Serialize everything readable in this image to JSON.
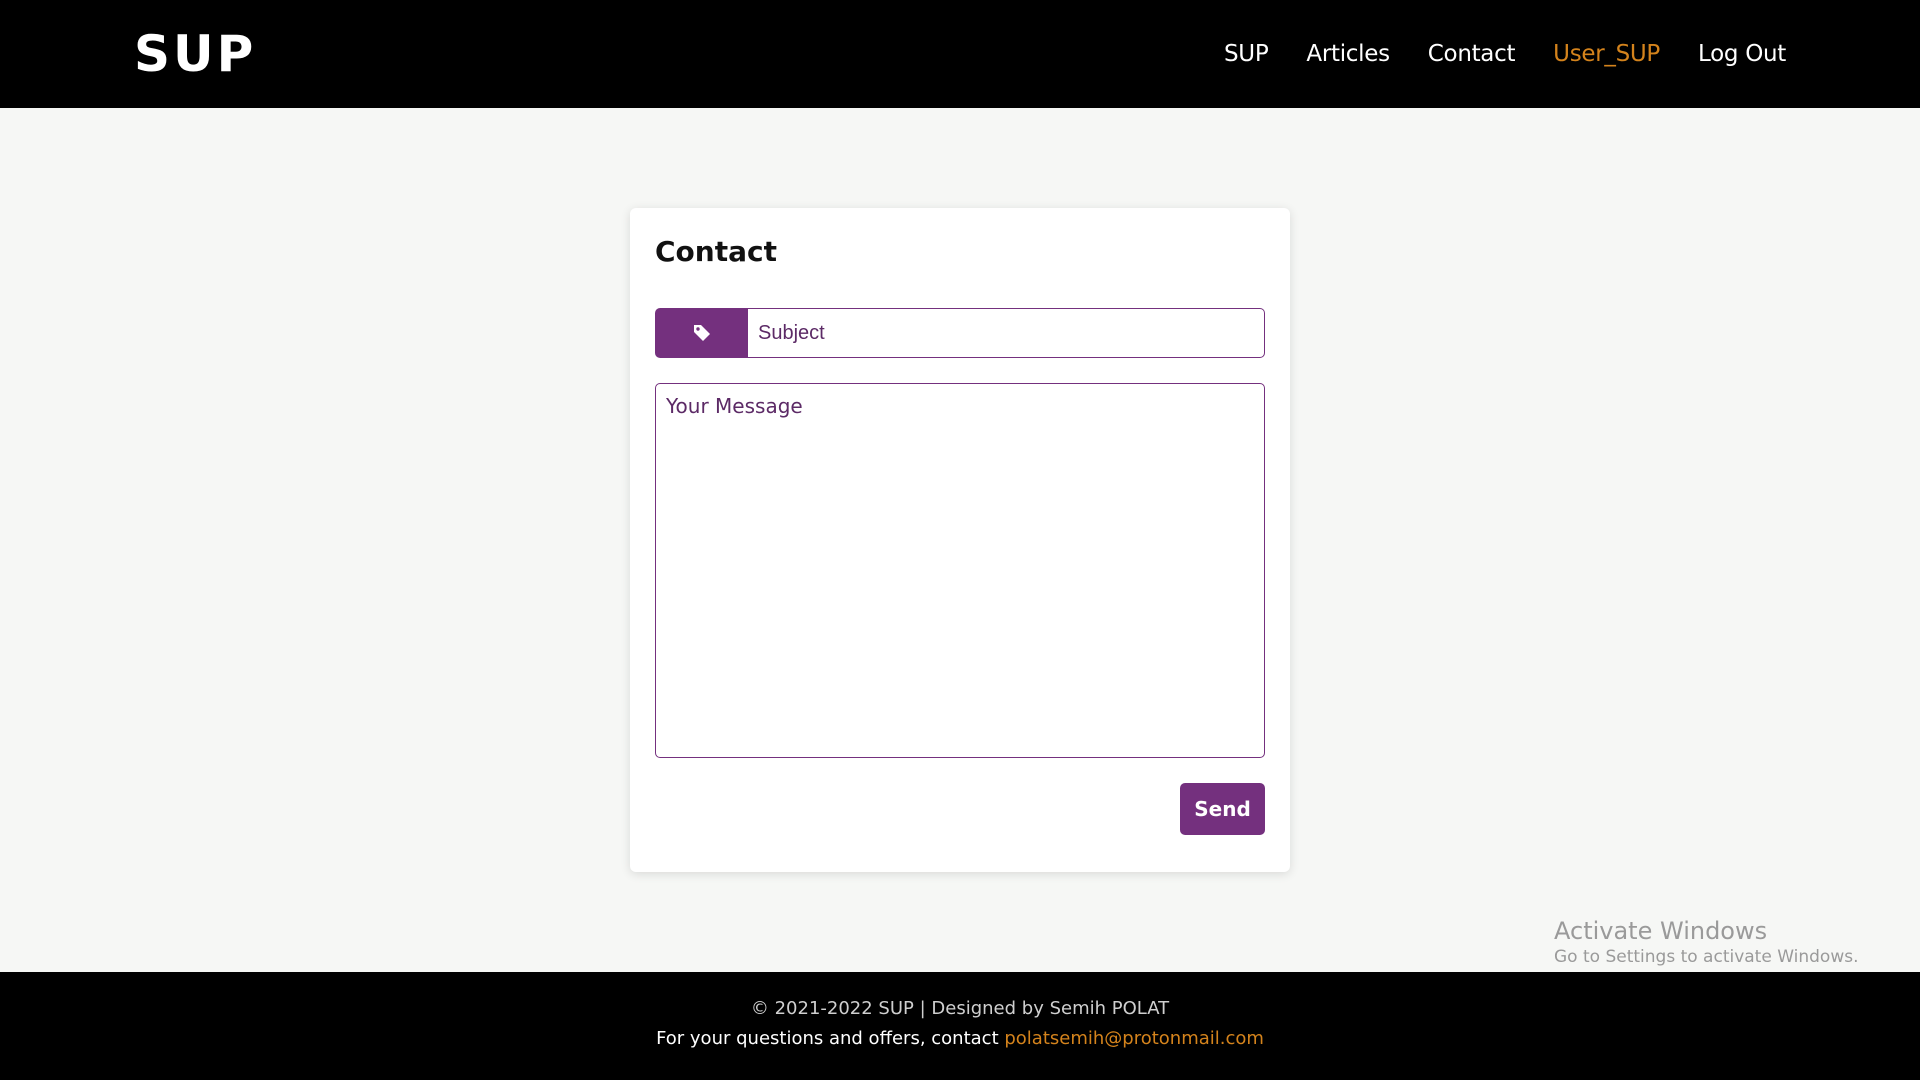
{
  "navbar": {
    "brand": "SUP",
    "links": [
      {
        "label": "SUP"
      },
      {
        "label": "Articles"
      },
      {
        "label": "Contact"
      },
      {
        "label": "User_SUP"
      },
      {
        "label": "Log Out"
      }
    ]
  },
  "contact": {
    "title": "Contact",
    "subject_placeholder": "Subject",
    "subject_icon": "tag-icon",
    "message_placeholder": "Your Message",
    "send_label": "Send"
  },
  "colors": {
    "accent": "#74307e",
    "highlight": "#d4831c",
    "header_bg": "#000000"
  },
  "watermark": {
    "title": "Activate Windows",
    "subtitle": "Go to Settings to activate Windows."
  },
  "footer": {
    "copyright": "© 2021-2022 SUP | Designed by Semih POLAT",
    "contact_text": "For your questions and offers, contact",
    "email": "polatsemih@protonmail.com"
  }
}
